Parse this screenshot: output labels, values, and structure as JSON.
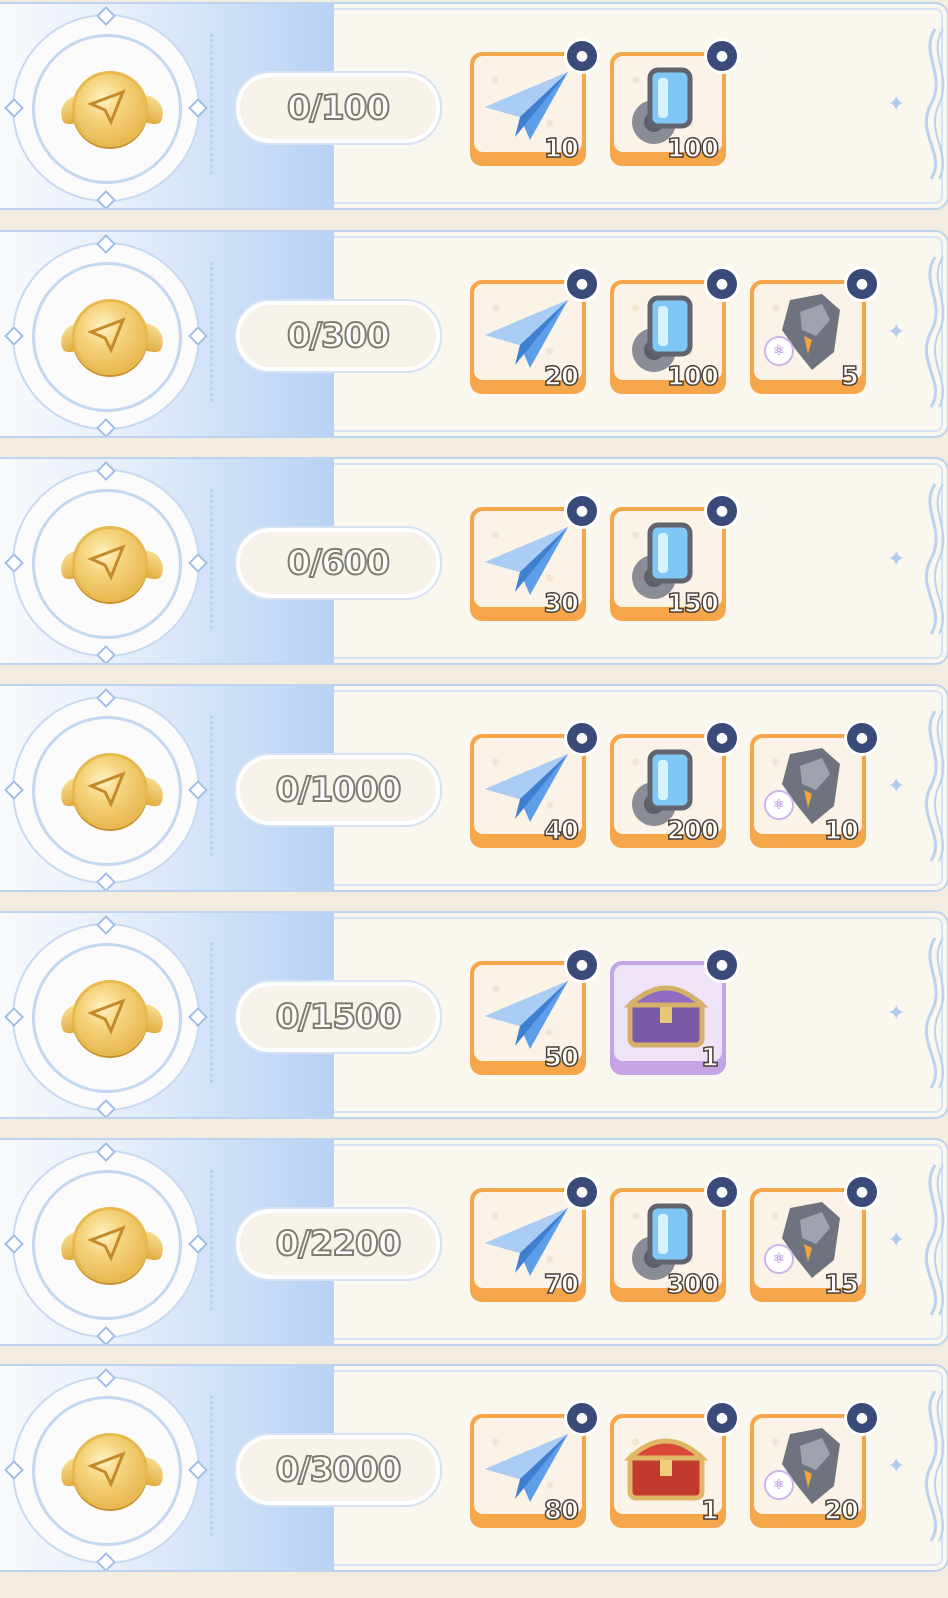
{
  "colors": {
    "page_bg": "#f3ece0",
    "row_bg": "#faf7ee",
    "row_border": "#bdd3ee",
    "reward_orange": "#f5a64a",
    "reward_purple": "#c5a4e6",
    "lock_badge": "#3a4b79"
  },
  "rows": [
    {
      "progress": "0/100",
      "rewards": [
        {
          "type": "paper-plane",
          "count": "10",
          "frame": "orange"
        },
        {
          "type": "gear-tube",
          "count": "100",
          "frame": "orange"
        }
      ]
    },
    {
      "progress": "0/300",
      "rewards": [
        {
          "type": "paper-plane",
          "count": "20",
          "frame": "orange"
        },
        {
          "type": "gear-tube",
          "count": "100",
          "frame": "orange"
        },
        {
          "type": "ore-chunk",
          "count": "5",
          "frame": "orange"
        }
      ]
    },
    {
      "progress": "0/600",
      "rewards": [
        {
          "type": "paper-plane",
          "count": "30",
          "frame": "orange"
        },
        {
          "type": "gear-tube",
          "count": "150",
          "frame": "orange"
        }
      ]
    },
    {
      "progress": "0/1000",
      "rewards": [
        {
          "type": "paper-plane",
          "count": "40",
          "frame": "orange"
        },
        {
          "type": "gear-tube",
          "count": "200",
          "frame": "orange"
        },
        {
          "type": "ore-chunk",
          "count": "10",
          "frame": "orange"
        }
      ]
    },
    {
      "progress": "0/1500",
      "rewards": [
        {
          "type": "paper-plane",
          "count": "50",
          "frame": "orange"
        },
        {
          "type": "purple-chest",
          "count": "1",
          "frame": "purple"
        }
      ]
    },
    {
      "progress": "0/2200",
      "rewards": [
        {
          "type": "paper-plane",
          "count": "70",
          "frame": "orange"
        },
        {
          "type": "gear-tube",
          "count": "300",
          "frame": "orange"
        },
        {
          "type": "ore-chunk",
          "count": "15",
          "frame": "orange"
        }
      ]
    },
    {
      "progress": "0/3000",
      "rewards": [
        {
          "type": "paper-plane",
          "count": "80",
          "frame": "orange"
        },
        {
          "type": "red-chest",
          "count": "1",
          "frame": "orange"
        },
        {
          "type": "ore-chunk",
          "count": "20",
          "frame": "orange"
        }
      ]
    }
  ]
}
